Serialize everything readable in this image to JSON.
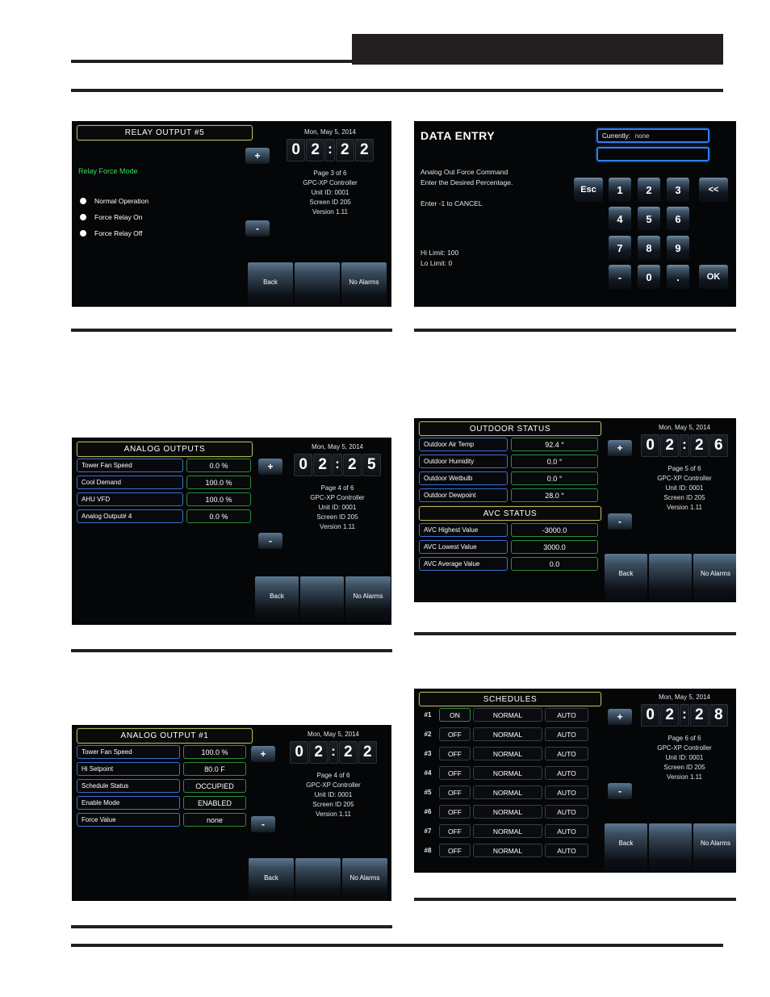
{
  "page": {
    "background": "#ffffff",
    "rule_color": "#231f20"
  },
  "common": {
    "date": "Mon, May 5, 2014",
    "plus_label": "+",
    "minus_label": "-",
    "softkeys": [
      "Back",
      "",
      "No Alarms"
    ],
    "controller": "GPC-XP Controller",
    "unit_id": "Unit ID: 0001",
    "screen_id": "Screen ID   205",
    "version": "Version  1.11"
  },
  "panels": {
    "relay_output": {
      "title": "RELAY OUTPUT #5",
      "section_label": "Relay Force Mode",
      "options": [
        "Normal Operation",
        "Force Relay On",
        "Force Relay Off"
      ],
      "clock": [
        "0",
        "2",
        ":",
        "2",
        "2"
      ],
      "page": "Page 3 of 6",
      "date": "Mon, May 5, 2014",
      "controller": "GPC-XP Controller",
      "unit_id": "Unit ID: 0001",
      "screen_id": "Screen ID   205",
      "version": "Version  1.11",
      "softkeys": [
        "Back",
        "",
        "No Alarms"
      ]
    },
    "data_entry": {
      "title": "DATA ENTRY",
      "prompt_line1": "Analog Out Force Command",
      "prompt_line2": "Enter the Desired Percentage.",
      "prompt_line3": "Enter -1 to CANCEL",
      "hi_limit": "Hi Limit:  100",
      "lo_limit": "Lo Limit:    0",
      "currently_label": "Currently:",
      "currently_value": "none",
      "input_value": "",
      "keys": {
        "esc": "Esc",
        "k1": "1",
        "k2": "2",
        "k3": "3",
        "back": "<<",
        "k4": "4",
        "k5": "5",
        "k6": "6",
        "k7": "7",
        "k8": "8",
        "k9": "9",
        "minus": "-",
        "k0": "0",
        "dot": ".",
        "ok": "OK"
      }
    },
    "analog_outputs": {
      "title": "ANALOG OUTPUTS",
      "rows": [
        {
          "label": "Tower Fan Speed",
          "value": "0.0  %"
        },
        {
          "label": "Cool Demand",
          "value": "100.0  %"
        },
        {
          "label": "AHU VFD",
          "value": "100.0  %"
        },
        {
          "label": "Analog Output# 4",
          "value": "0.0  %"
        }
      ],
      "clock": [
        "0",
        "2",
        ":",
        "2",
        "5"
      ],
      "page": "Page 4 of 6",
      "date": "Mon, May 5, 2014",
      "controller": "GPC-XP Controller",
      "unit_id": "Unit ID: 0001",
      "screen_id": "Screen ID   205",
      "version": "Version  1.11",
      "softkeys": [
        "Back",
        "",
        "No Alarms"
      ]
    },
    "outdoor_status": {
      "title": "OUTDOOR STATUS",
      "rows": [
        {
          "label": "Outdoor Air Temp",
          "value": "92.4 °"
        },
        {
          "label": "Outdoor Humidity",
          "value": "0.0 °"
        },
        {
          "label": "Outdoor Wetbulb",
          "value": "0.0 °"
        },
        {
          "label": "Outdoor Dewpoint",
          "value": "28.0 °"
        }
      ],
      "avc_title": "AVC STATUS",
      "avc_rows": [
        {
          "label": "AVC Highest Value",
          "value": "-3000.0"
        },
        {
          "label": "AVC Lowest Value",
          "value": "3000.0"
        },
        {
          "label": "AVC Average Value",
          "value": "0.0"
        }
      ],
      "clock": [
        "0",
        "2",
        ":",
        "2",
        "6"
      ],
      "page": "Page 5 of 6",
      "date": "Mon, May 5, 2014",
      "controller": "GPC-XP Controller",
      "unit_id": "Unit ID: 0001",
      "screen_id": "Screen ID   205",
      "version": "Version  1.11",
      "softkeys": [
        "Back",
        "",
        "No Alarms"
      ]
    },
    "analog_output_1": {
      "title": "ANALOG OUTPUT #1",
      "rows": [
        {
          "label": "Tower Fan Speed",
          "value": "100.0 %"
        },
        {
          "label": "Hi Setpoint",
          "value": "80.0 F"
        },
        {
          "label": "Schedule Status",
          "value": "OCCUPIED"
        },
        {
          "label": "Enable Mode",
          "value": "ENABLED"
        },
        {
          "label": "Force Value",
          "value": "none"
        }
      ],
      "clock": [
        "0",
        "2",
        ":",
        "2",
        "2"
      ],
      "page": "Page 4 of 6",
      "date": "Mon, May 5, 2014",
      "controller": "GPC-XP Controller",
      "unit_id": "Unit ID: 0001",
      "screen_id": "Screen ID   205",
      "version": "Version  1.11",
      "softkeys": [
        "Back",
        "",
        "No Alarms"
      ]
    },
    "schedules": {
      "title": "SCHEDULES",
      "rows": [
        {
          "index": "#1",
          "state": "ON",
          "mode": "NORMAL",
          "auto": "AUTO",
          "active": true
        },
        {
          "index": "#2",
          "state": "OFF",
          "mode": "NORMAL",
          "auto": "AUTO",
          "active": false
        },
        {
          "index": "#3",
          "state": "OFF",
          "mode": "NORMAL",
          "auto": "AUTO",
          "active": false
        },
        {
          "index": "#4",
          "state": "OFF",
          "mode": "NORMAL",
          "auto": "AUTO",
          "active": false
        },
        {
          "index": "#5",
          "state": "OFF",
          "mode": "NORMAL",
          "auto": "AUTO",
          "active": false
        },
        {
          "index": "#6",
          "state": "OFF",
          "mode": "NORMAL",
          "auto": "AUTO",
          "active": false
        },
        {
          "index": "#7",
          "state": "OFF",
          "mode": "NORMAL",
          "auto": "AUTO",
          "active": false
        },
        {
          "index": "#8",
          "state": "OFF",
          "mode": "NORMAL",
          "auto": "AUTO",
          "active": false
        }
      ],
      "clock": [
        "0",
        "2",
        ":",
        "2",
        "8"
      ],
      "page": "Page 6 of 6",
      "date": "Mon, May 5, 2014",
      "controller": "GPC-XP Controller",
      "unit_id": "Unit ID: 0001",
      "screen_id": "Screen ID   205",
      "version": "Version  1.11",
      "softkeys": [
        "Back",
        "",
        "No Alarms"
      ]
    }
  }
}
